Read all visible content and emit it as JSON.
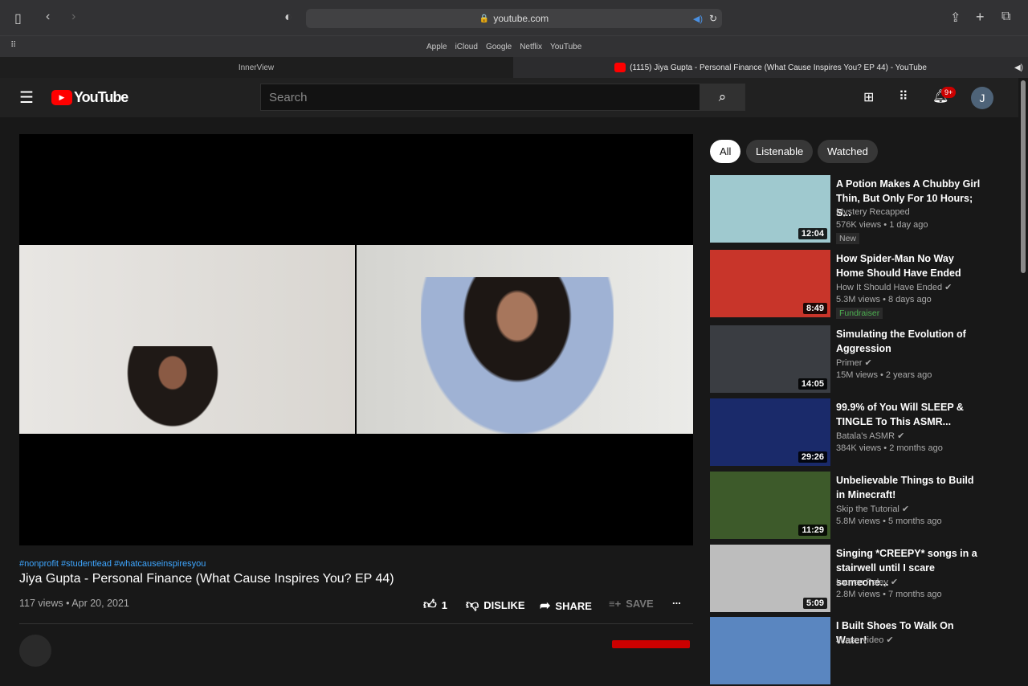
{
  "browser": {
    "url": "youtube.com",
    "bookmarks": [
      "Apple",
      "iCloud",
      "Google",
      "Netflix",
      "YouTube"
    ],
    "tabs": [
      {
        "label": "InnerView"
      },
      {
        "label": "(1115) Jiya Gupta - Personal Finance (What Cause Inspires You? EP 44) - YouTube"
      }
    ]
  },
  "header": {
    "logo": "YouTube",
    "search_placeholder": "Search",
    "notifications": "9+",
    "avatar": "J"
  },
  "video": {
    "hashtags": "#nonprofit #studentlead #whatcauseinspiresyou",
    "title": "Jiya Gupta - Personal Finance (What Cause Inspires You? EP 44)",
    "meta": "117 views • Apr 20, 2021",
    "likes": "1",
    "dislike": "DISLIKE",
    "share": "SHARE",
    "save": "SAVE",
    "more": "..."
  },
  "chips": [
    "All",
    "Listenable",
    "Watched"
  ],
  "recommendations": [
    {
      "title": "A Potion Makes A Chubby Girl Thin, But Only For 10 Hours; S...",
      "channel": "Mystery Recapped",
      "meta": "576K views • 1 day ago",
      "duration": "12:04",
      "badge": "New",
      "thumb": "#9fc9cf"
    },
    {
      "title": "How Spider-Man No Way Home Should Have Ended",
      "channel": "How It Should Have Ended ✔",
      "meta": "5.3M views • 8 days ago",
      "duration": "8:49",
      "badge": "Fundraiser",
      "thumb": "#c8352a"
    },
    {
      "title": "Simulating the Evolution of Aggression",
      "channel": "Primer ✔",
      "meta": "15M views • 2 years ago",
      "duration": "14:05",
      "thumb": "#3a3d42"
    },
    {
      "title": "99.9% of You Will SLEEP & TINGLE To This ASMR...",
      "channel": "Batala's ASMR ✔",
      "meta": "384K views • 2 months ago",
      "duration": "29:26",
      "thumb": "#1a2a6a"
    },
    {
      "title": "Unbelievable Things to Build in Minecraft!",
      "channel": "Skip the Tutorial ✔",
      "meta": "5.8M views • 5 months ago",
      "duration": "11:29",
      "thumb": "#3d5a2a"
    },
    {
      "title": "Singing *CREEPY* songs in a stairwell until I scare someone...",
      "channel": "Lauren Paley ✔",
      "meta": "2.8M views • 7 months ago",
      "duration": "5:09",
      "thumb": "#bdbdbd"
    },
    {
      "title": "I Built Shoes To Walk On Water!",
      "channel": "JLaservideo ✔",
      "meta": "",
      "duration": "",
      "thumb": "#5a86c0"
    }
  ]
}
